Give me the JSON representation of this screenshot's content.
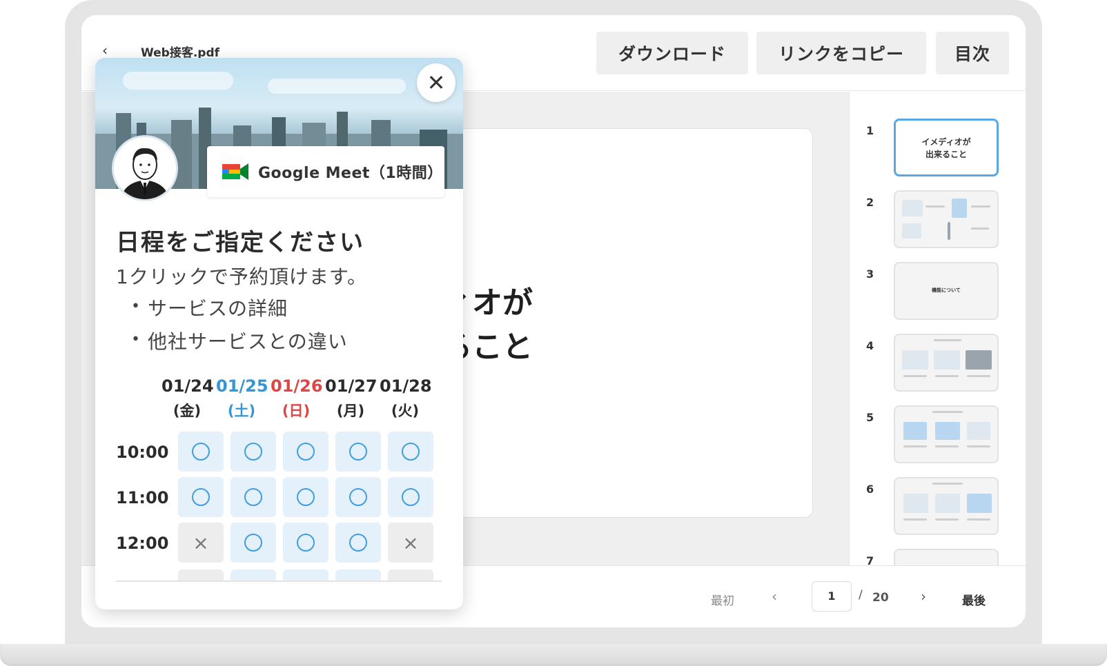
{
  "toolbar": {
    "file_name": "Web接客.pdf",
    "download_label": "ダウンロード",
    "copy_link_label": "リンクをコピー",
    "toc_label": "目次"
  },
  "slide": {
    "title_line1": "ィオが",
    "title_line2": "ること"
  },
  "thumbnails": [
    {
      "number": "1",
      "text_line1": "イメディオが",
      "text_line2": "出来ること",
      "active": true
    },
    {
      "number": "2",
      "active": false
    },
    {
      "number": "3",
      "text_line1": "機能について",
      "active": false
    },
    {
      "number": "4",
      "active": false
    },
    {
      "number": "5",
      "active": false
    },
    {
      "number": "6",
      "active": false
    },
    {
      "number": "7",
      "active": false
    }
  ],
  "pagination": {
    "first_label": "最初",
    "current_page": "1",
    "separator": "/",
    "total_pages": "20",
    "last_label": "最後"
  },
  "booking": {
    "meeting_type": "Google Meet（1時間）",
    "title": "日程をご指定ください",
    "description": "1クリックで予約頂けます。",
    "bullets": [
      "サービスの詳細",
      "他社サービスとの違い"
    ],
    "dates": [
      {
        "date": "01/24",
        "dow": "(金)",
        "kind": "weekday"
      },
      {
        "date": "01/25",
        "dow": "(土)",
        "kind": "saturday"
      },
      {
        "date": "01/26",
        "dow": "(日)",
        "kind": "sunday"
      },
      {
        "date": "01/27",
        "dow": "(月)",
        "kind": "weekday"
      },
      {
        "date": "01/28",
        "dow": "(火)",
        "kind": "weekday"
      }
    ],
    "times": [
      {
        "time": "10:00",
        "slots": [
          "available",
          "available",
          "available",
          "available",
          "available"
        ]
      },
      {
        "time": "11:00",
        "slots": [
          "available",
          "available",
          "available",
          "available",
          "available"
        ]
      },
      {
        "time": "12:00",
        "slots": [
          "unavailable",
          "available",
          "available",
          "available",
          "unavailable"
        ]
      }
    ],
    "unavailable_mark": "×",
    "colors": {
      "saturday": "#3596d6",
      "sunday": "#e04545",
      "slot_available_bg": "#e4f1fb",
      "slot_ring": "#3f9de0",
      "slot_unavailable_bg": "#ededed"
    }
  }
}
